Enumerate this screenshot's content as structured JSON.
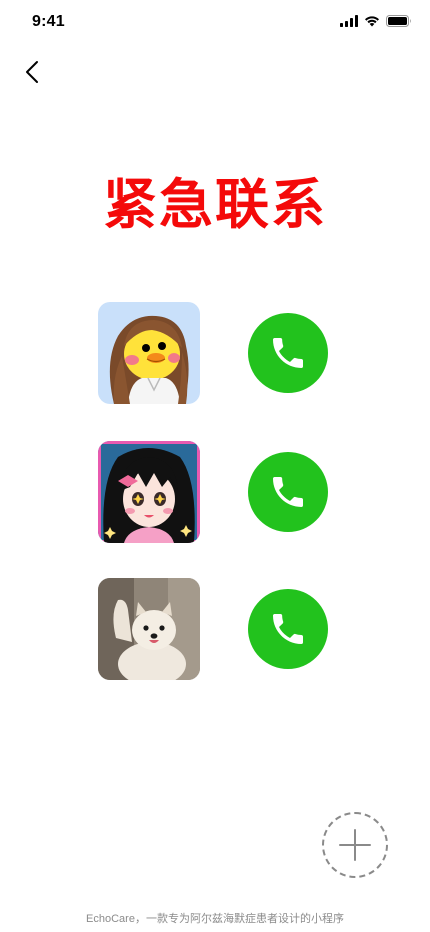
{
  "status_bar": {
    "time": "9:41",
    "icons": [
      "signal-icon",
      "wifi-icon",
      "battery-icon"
    ]
  },
  "header": {
    "back_icon": "chevron-left-icon"
  },
  "title": "紧急联系",
  "colors": {
    "title": "#f40a0a",
    "call_button": "#22c21d",
    "footer_text": "#8c8c8c"
  },
  "contacts": [
    {
      "avatar": "duck-girl-avatar",
      "call_icon": "phone-icon"
    },
    {
      "avatar": "anime-girl-avatar",
      "call_icon": "phone-icon"
    },
    {
      "avatar": "puppy-avatar",
      "call_icon": "phone-icon"
    }
  ],
  "add_button": {
    "icon": "plus-icon"
  },
  "footer": "EchoCare，一款专为阿尔兹海默症患者设计的小程序"
}
